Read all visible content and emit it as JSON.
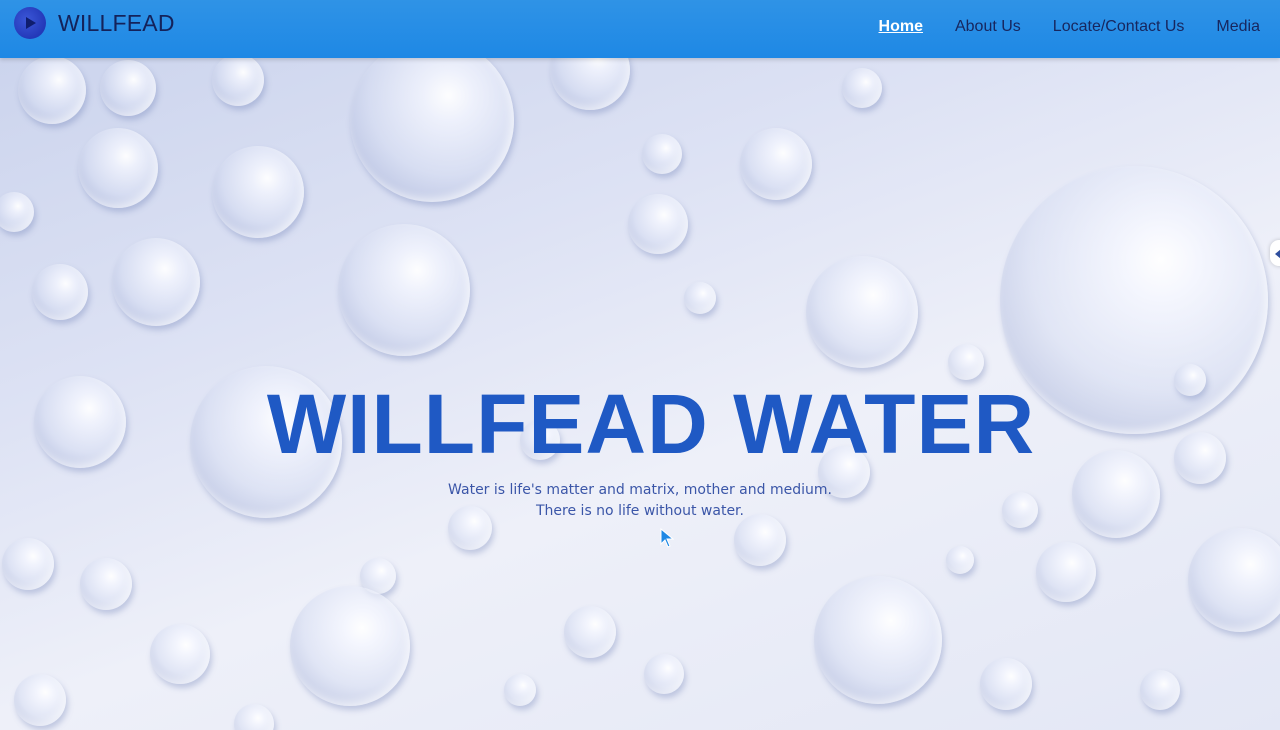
{
  "brand": {
    "name": "WILLFEAD"
  },
  "nav": {
    "items": [
      {
        "label": "Home",
        "active": true
      },
      {
        "label": "About Us",
        "active": false
      },
      {
        "label": "Locate/Contact Us",
        "active": false
      },
      {
        "label": "Media",
        "active": false
      }
    ]
  },
  "hero": {
    "title": "WILLFEAD WATER",
    "line1": "Water is life's matter and matrix, mother and medium.",
    "line2": "There is no life without water."
  },
  "colors": {
    "navbar": "#1e88e5",
    "title": "#1f59c4",
    "background": "#dde2f4"
  },
  "icons": {
    "logo": "play-circle-icon",
    "cursor": "mouse-pointer-icon",
    "side_tab": "chevron-left-icon"
  }
}
